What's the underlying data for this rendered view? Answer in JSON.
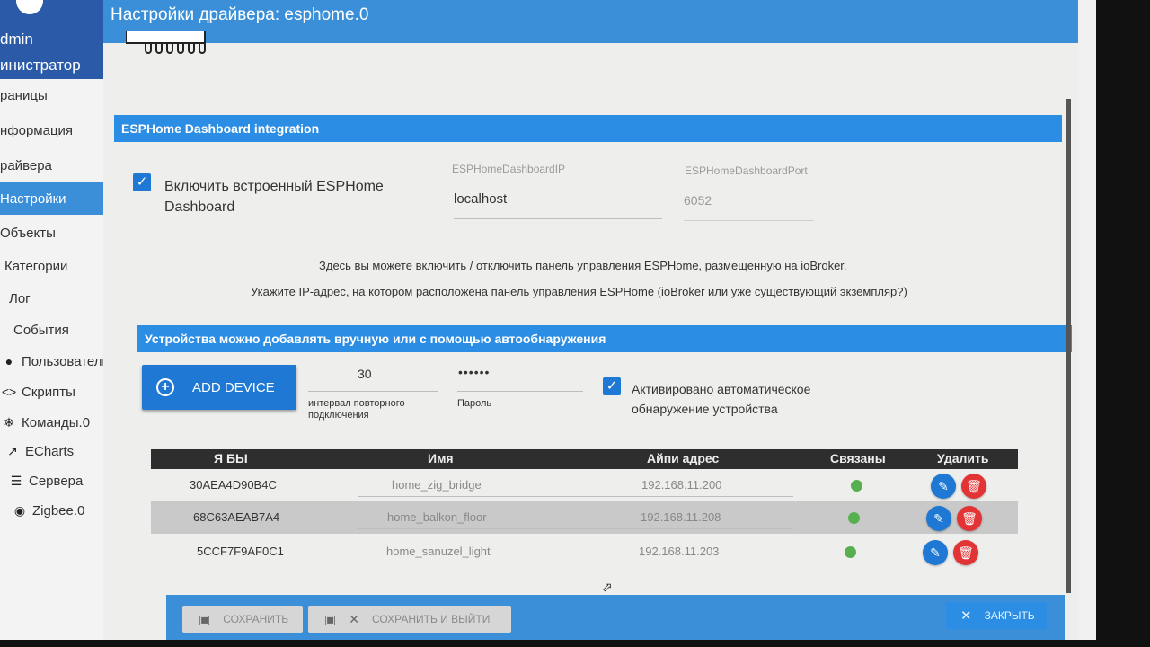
{
  "sidebar": {
    "user_name": "dmin",
    "user_role": "инистратор",
    "items": [
      {
        "label": "раницы",
        "icon": ""
      },
      {
        "label": "нформация",
        "icon": ""
      },
      {
        "label": "райвера",
        "icon": ""
      },
      {
        "label": "Настройки",
        "icon": "",
        "active": true
      },
      {
        "label": "Объекты",
        "icon": ""
      },
      {
        "label": "Категории",
        "icon": ""
      },
      {
        "label": "Лог",
        "icon": ""
      },
      {
        "label": "События",
        "icon": ""
      },
      {
        "label": "Пользователи",
        "icon": "user-icon"
      },
      {
        "label": "Скрипты",
        "icon": "code-icon"
      },
      {
        "label": "Команды.0",
        "icon": "snowflake-icon"
      },
      {
        "label": "ECharts",
        "icon": "chart-line-icon"
      },
      {
        "label": "Сервера",
        "icon": "list-icon"
      },
      {
        "label": "Zigbee.0",
        "icon": "zigbee-icon"
      }
    ]
  },
  "dialog": {
    "title": "Настройки драйвера: esphome.0"
  },
  "dashboard": {
    "section_title": "ESPHome Dashboard integration",
    "enable_label_line1": "Включить встроенный ESPHome",
    "enable_label_line2": "Dashboard",
    "enable_checked": true,
    "ip_label": "ESPHomeDashboardIP",
    "ip_value": "localhost",
    "port_label": "ESPHomeDashboardPort",
    "port_value": "6052",
    "info_line1": "Здесь вы можете включить / отключить панель управления ESPHome, размещенную на ioBroker.",
    "info_line2": "Укажите IP-адрес, на котором расположена панель управления ESPHome (ioBroker или уже существующий экземпляр?)"
  },
  "devices": {
    "section_title": "Устройства можно добавлять вручную или с помощью автообнаружения",
    "add_device_label": "ADD DEVICE",
    "reconnect_value": "30",
    "reconnect_label_line1": "интервал повторного",
    "reconnect_label_line2": "подключения",
    "password_value": "••••••",
    "password_label": "Пароль",
    "autodiscovery_checked": true,
    "autodiscovery_line1": "Активировано автоматическое",
    "autodiscovery_line2": "обнаружение устройства",
    "columns": {
      "id": "Я БЫ",
      "name": "Имя",
      "ip": "Айпи адрес",
      "connected": "Связаны",
      "delete": "Удалить"
    },
    "rows": [
      {
        "id": "30AEA4D90B4C",
        "name": "home_zig_bridge",
        "ip": "192.168.11.200",
        "connected": true
      },
      {
        "id": "68C63AEAB7A4",
        "name": "home_balkon_floor",
        "ip": "192.168.11.208",
        "connected": true
      },
      {
        "id": "5CCF7F9AF0C1",
        "name": "home_sanuzel_light",
        "ip": "192.168.11.203",
        "connected": true
      }
    ]
  },
  "footer": {
    "save_label": "СОХРАНИТЬ",
    "save_exit_label": "СОХРАНИТЬ И ВЫЙТИ",
    "close_label": "ЗАКРЫТЬ"
  },
  "colors": {
    "accent": "#3a8fd8",
    "section_bar": "#2b8de4",
    "button": "#1e78d4",
    "delete": "#e23434",
    "status_ok": "#56b050"
  }
}
